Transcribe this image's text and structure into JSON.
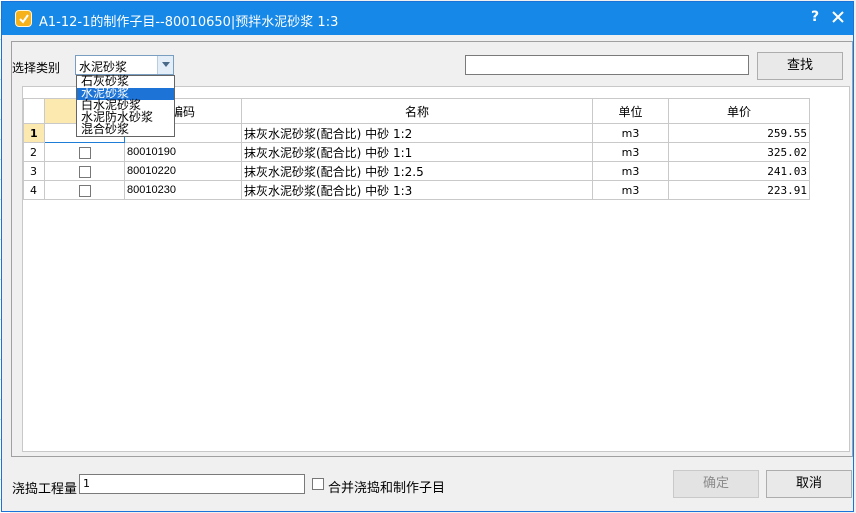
{
  "window": {
    "title": "A1-12-1的制作子目--80010650|预拌水泥砂浆 1:3",
    "help_label": "?"
  },
  "filter": {
    "category_label": "选择类别",
    "category_value": "水泥砂浆",
    "find_label": "查找",
    "search_value": ""
  },
  "dropdown": {
    "options": [
      "石灰砂浆",
      "水泥砂浆",
      "白水泥砂浆",
      "水泥防水砂浆",
      "混合砂浆"
    ],
    "selected_index": 1
  },
  "table": {
    "columns": {
      "select": "选",
      "code": "编码",
      "name": "名称",
      "unit": "单位",
      "price": "单价"
    },
    "rows": [
      {
        "num": "1",
        "code": "",
        "name": "抹灰水泥砂浆(配合比) 中砂 1:2",
        "unit": "m3",
        "price": "259.55"
      },
      {
        "num": "2",
        "code": "80010190",
        "name": "抹灰水泥砂浆(配合比) 中砂 1:1",
        "unit": "m3",
        "price": "325.02"
      },
      {
        "num": "3",
        "code": "80010220",
        "name": "抹灰水泥砂浆(配合比) 中砂 1:2.5",
        "unit": "m3",
        "price": "241.03"
      },
      {
        "num": "4",
        "code": "80010230",
        "name": "抹灰水泥砂浆(配合比) 中砂 1:3",
        "unit": "m3",
        "price": "223.91"
      }
    ]
  },
  "footer": {
    "qty_label": "浇捣工程量",
    "qty_value": "1",
    "merge_label": "合并浇捣和制作子目",
    "ok_label": "确定",
    "cancel_label": "取消"
  },
  "colors": {
    "titlebar": "#1688e8",
    "selection": "#1e74d6",
    "active_header": "#fce9b0"
  }
}
